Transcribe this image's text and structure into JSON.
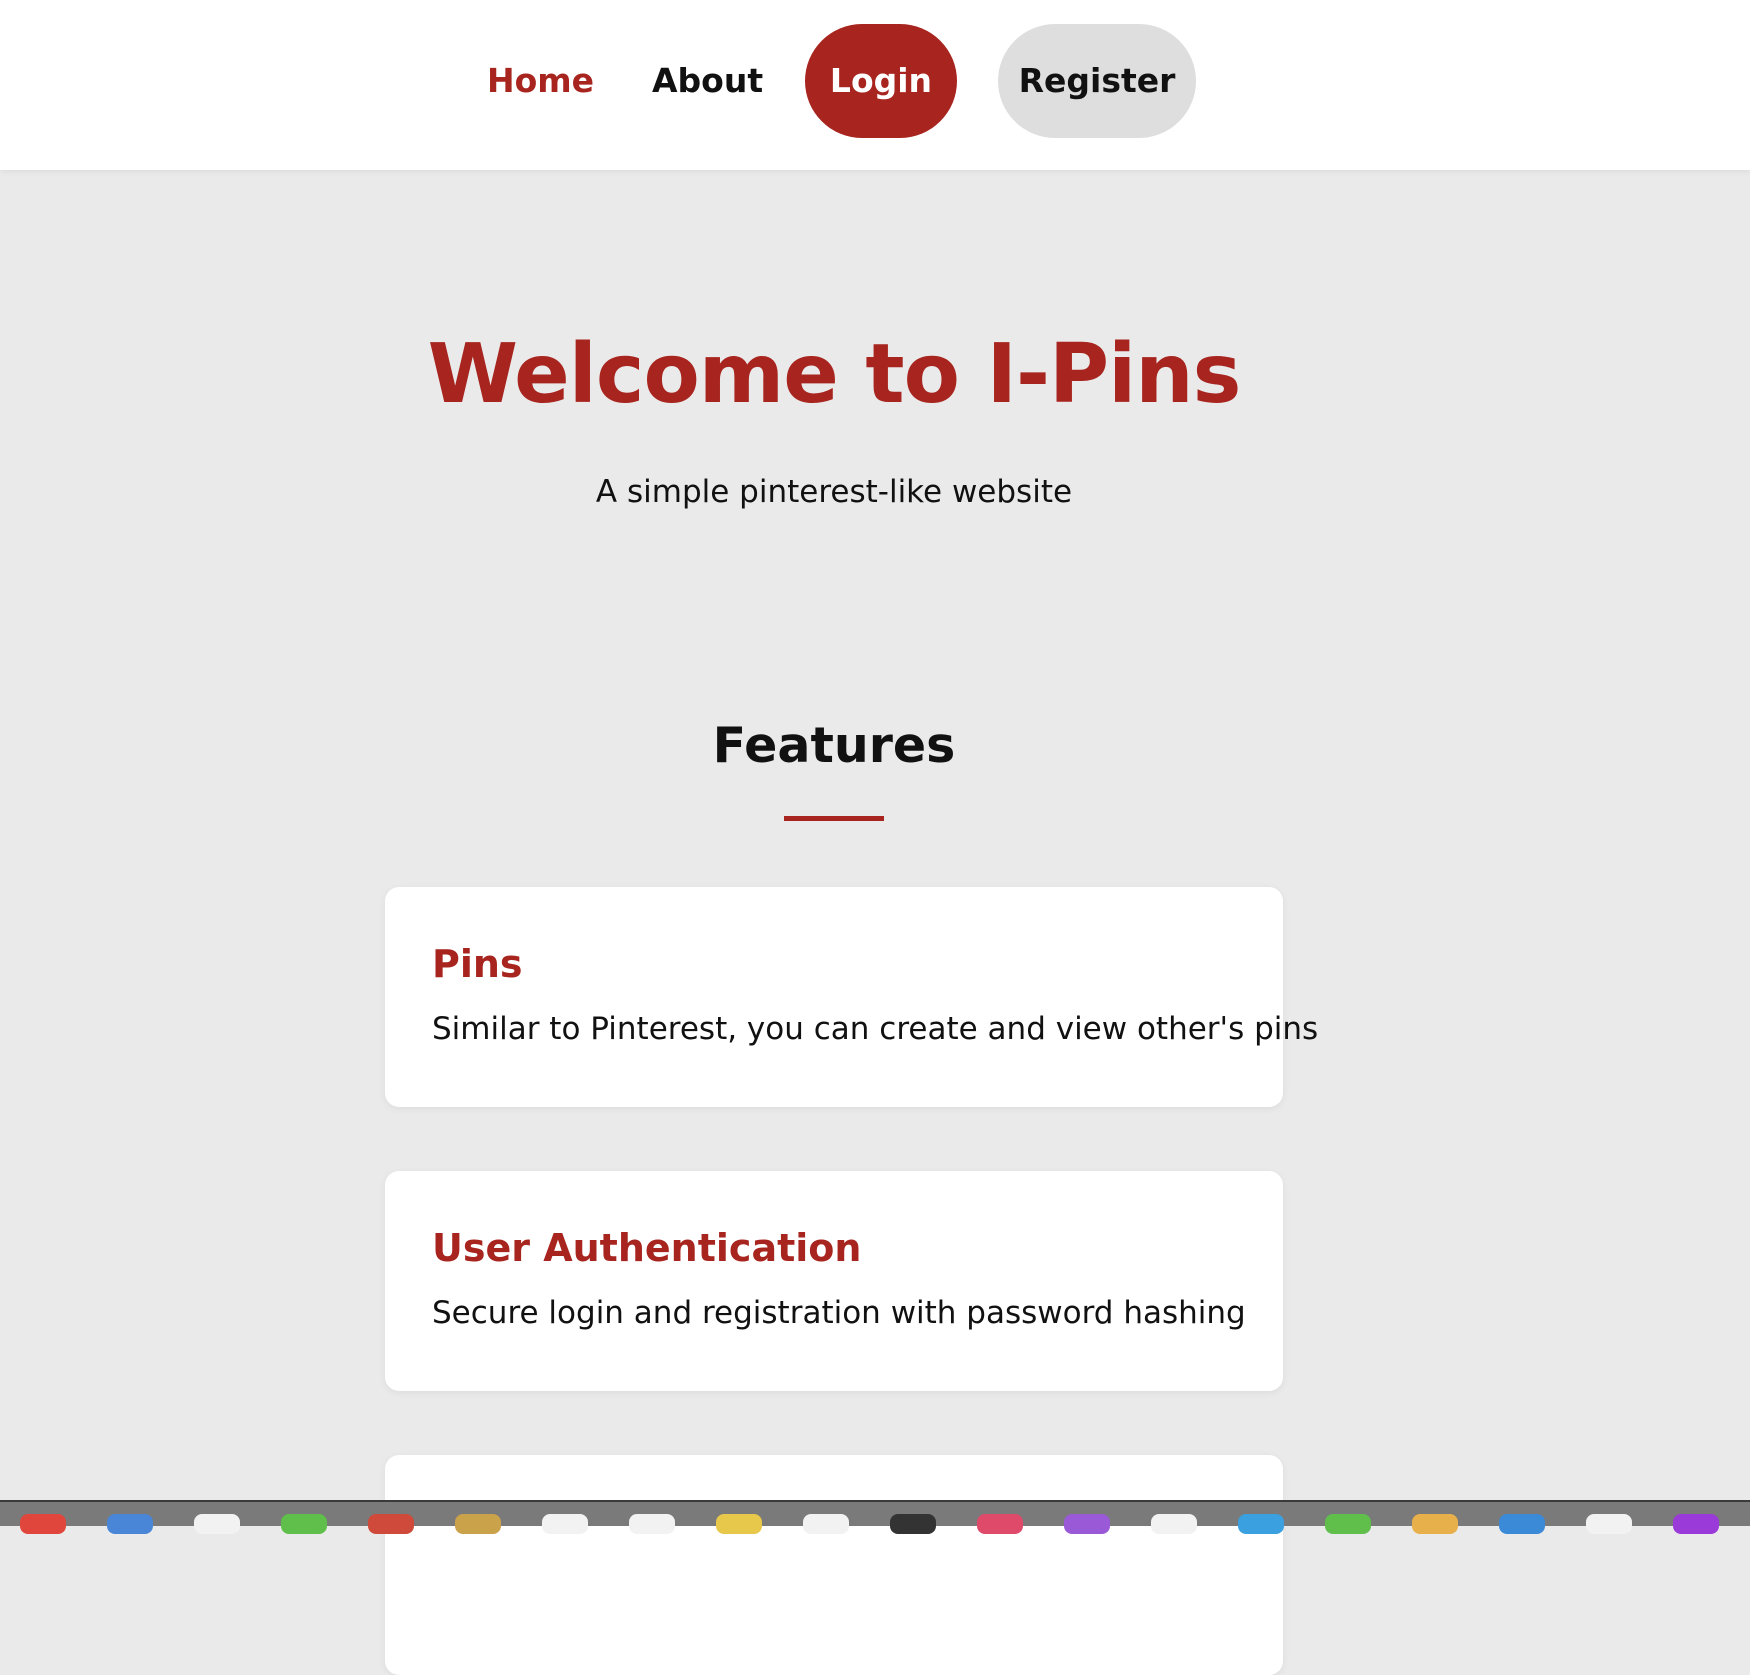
{
  "nav": {
    "home": "Home",
    "about": "About",
    "login": "Login",
    "register": "Register"
  },
  "hero": {
    "title": "Welcome to I-Pins",
    "subtitle": "A simple pinterest-like website"
  },
  "features": {
    "title": "Features",
    "items": [
      {
        "title": "Pins",
        "description": "Similar to Pinterest, you can create and view other's pins"
      },
      {
        "title": "User Authentication",
        "description": "Secure login and registration with password hashing"
      },
      {
        "title": "",
        "description": ""
      }
    ]
  },
  "colors": {
    "accent": "#a8241e",
    "background": "#eaeaea",
    "card": "#ffffff",
    "register_bg": "#dedede"
  },
  "dock": {
    "icons": [
      "finder-icon",
      "safari-icon",
      "app-icon",
      "app-icon",
      "app-icon",
      "app-icon",
      "app-icon",
      "app-icon",
      "app-icon",
      "app-icon",
      "app-icon",
      "app-icon",
      "app-icon",
      "app-icon",
      "app-icon",
      "app-icon",
      "app-icon",
      "app-icon",
      "app-icon",
      "app-icon"
    ]
  }
}
